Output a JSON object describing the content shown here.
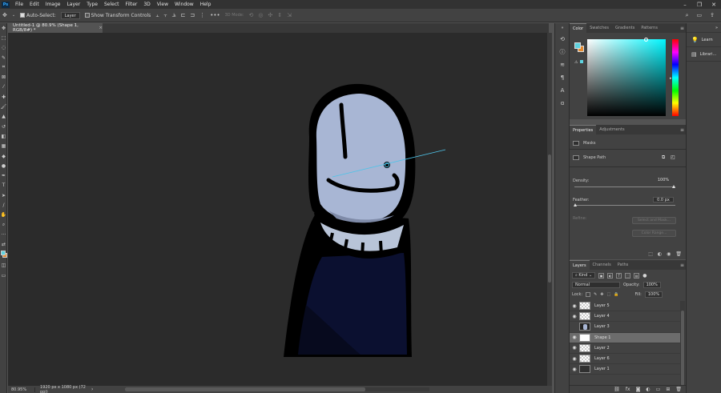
{
  "menubar": {
    "logo": "Ps",
    "items": [
      "File",
      "Edit",
      "Image",
      "Layer",
      "Type",
      "Select",
      "Filter",
      "3D",
      "View",
      "Window",
      "Help"
    ]
  },
  "optionsbar": {
    "auto_select_label": "Auto-Select:",
    "auto_select_value": "Layer",
    "transform_label": "Show Transform Controls",
    "mode_3d": "3D Mode:"
  },
  "document": {
    "tab_title": "Untitled-1 @ 80.9% (Shape 1, RGB/8#) *",
    "close": "×"
  },
  "status": {
    "zoom": "80.95%",
    "info": "1920 px x 1080 px (72 ppi)"
  },
  "colors": {
    "foreground": "#5ed3e0",
    "background": "#e58a2e",
    "canvas_bg": "#2b2b2b",
    "face": "#a8b6d4",
    "outline": "#000000",
    "sweater": "#0b1030"
  },
  "color_panel": {
    "tabs": [
      "Color",
      "Swatches",
      "Gradients",
      "Patterns"
    ]
  },
  "properties_panel": {
    "tabs": [
      "Properties",
      "Adjustments"
    ],
    "masks_label": "Masks",
    "shape_path_label": "Shape Path",
    "density_label": "Density:",
    "density_value": "100%",
    "feather_label": "Feather:",
    "feather_value": "0.0 px",
    "refine_label": "Refine:",
    "select_mask_button": "Select and Mask...",
    "color_range_button": "Color Range..."
  },
  "layers_panel": {
    "tabs": [
      "Layers",
      "Channels",
      "Paths"
    ],
    "filter_kind": "Kind",
    "blend_mode": "Normal",
    "opacity_label": "Opacity:",
    "opacity_value": "100%",
    "lock_label": "Lock:",
    "fill_label": "Fill:",
    "fill_value": "100%",
    "layers": [
      {
        "name": "Layer 5",
        "visible": true,
        "thumb": "transparent",
        "selected": false
      },
      {
        "name": "Layer 4",
        "visible": true,
        "thumb": "transparent",
        "selected": false
      },
      {
        "name": "Layer 3",
        "visible": false,
        "thumb": "char",
        "selected": false
      },
      {
        "name": "Shape 1",
        "visible": true,
        "thumb": "shape",
        "selected": true
      },
      {
        "name": "Layer 2",
        "visible": true,
        "thumb": "transparent",
        "selected": false
      },
      {
        "name": "Layer 6",
        "visible": true,
        "thumb": "transparent",
        "selected": false
      },
      {
        "name": "Layer 1",
        "visible": true,
        "thumb": "dark",
        "selected": false
      }
    ]
  },
  "learn_strip": {
    "learn_label": "Learn",
    "libraries_label": "Librari..."
  }
}
